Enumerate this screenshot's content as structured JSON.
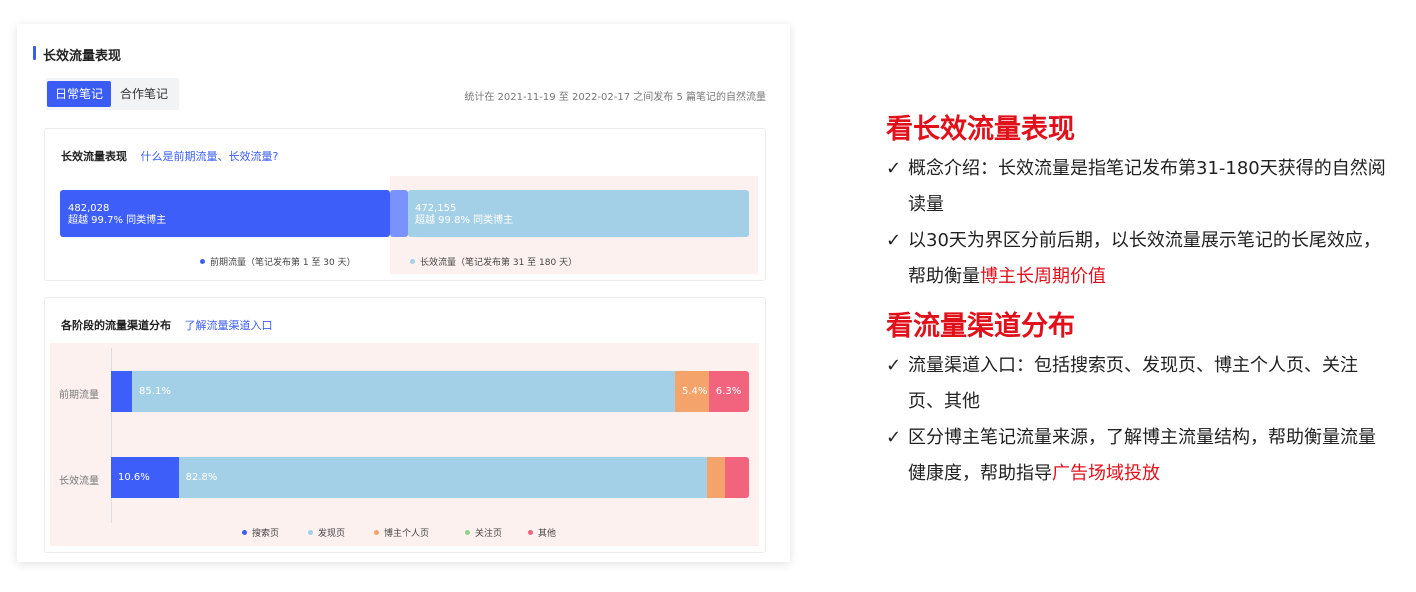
{
  "card": {
    "title": "长效流量表现",
    "tabs": [
      {
        "label": "日常笔记",
        "active": true
      },
      {
        "label": "合作笔记",
        "active": false
      }
    ],
    "stat_note": "统计在 2021-11-19 至 2022-02-17 之间发布 5 篇笔记的自然流量"
  },
  "panel1": {
    "title": "长效流量表现",
    "link": "什么是前期流量、长效流量?",
    "early": {
      "value": "482,028",
      "sub": "超越 99.7% 同类博主",
      "amount": 482028
    },
    "long": {
      "value": "472,155",
      "sub": "超越 99.8% 同类博主",
      "amount": 472155
    },
    "legend": [
      {
        "label": "前期流量（笔记发布第 1 至 30 天）",
        "color": "#3e5ef9"
      },
      {
        "label": "长效流量（笔记发布第 31 至 180 天）",
        "color": "#a3d0e6"
      }
    ]
  },
  "panel2": {
    "title": "各阶段的流量渠道分布",
    "link": "了解流量渠道入口",
    "rows": [
      {
        "label": "前期流量",
        "segments": [
          {
            "pct": 3.3,
            "text": ""
          },
          {
            "pct": 85.1,
            "text": "85.1%"
          },
          {
            "pct": 5.3,
            "text": "5.4%"
          },
          {
            "pct": 0.0,
            "text": ""
          },
          {
            "pct": 6.3,
            "text": "6.3%"
          }
        ]
      },
      {
        "label": "长效流量",
        "segments": [
          {
            "pct": 10.6,
            "text": "10.6%"
          },
          {
            "pct": 82.8,
            "text": "82.8%"
          },
          {
            "pct": 2.8,
            "text": ""
          },
          {
            "pct": 0.0,
            "text": ""
          },
          {
            "pct": 3.8,
            "text": ""
          }
        ]
      }
    ],
    "legend": [
      {
        "label": "搜索页",
        "color": "#3e5ef9"
      },
      {
        "label": "发现页",
        "color": "#a3d0e6"
      },
      {
        "label": "博主个人页",
        "color": "#f4a36b"
      },
      {
        "label": "关注页",
        "color": "#8fd18c"
      },
      {
        "label": "其他",
        "color": "#f2647e"
      }
    ]
  },
  "side": {
    "heading1": "看长效流量表现",
    "list1": [
      {
        "check": "✓",
        "text": "概念介绍：长效流量是指笔记发布第31-180天获得的自然阅读量",
        "red": ""
      },
      {
        "check": "✓",
        "text": "以30天为界区分前后期，以长效流量展示笔记的长尾效应，帮助衡量",
        "red": "博主长周期价值"
      }
    ],
    "heading2": "看流量渠道分布",
    "list2": [
      {
        "check": "✓",
        "text": "流量渠道入口：包括搜索页、发现页、博主个人页、关注页、其他",
        "red": ""
      },
      {
        "check": "✓",
        "text": "区分博主笔记流量来源，了解博主流量结构，帮助衡量流量健康度，帮助指导",
        "red": "广告场域投放"
      }
    ]
  }
}
